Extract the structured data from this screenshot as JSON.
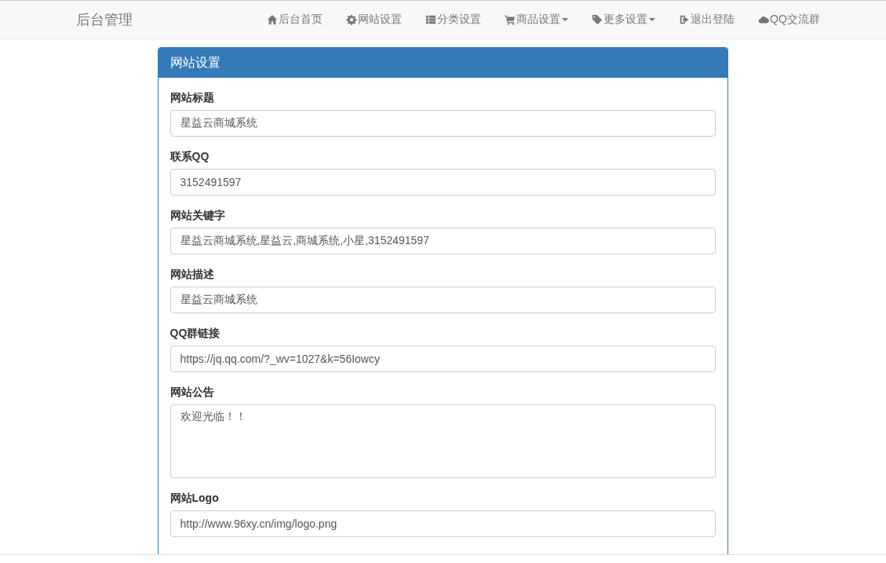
{
  "navbar": {
    "brand": "后台管理",
    "items": [
      {
        "label": "后台首页",
        "dropdown": false
      },
      {
        "label": "网站设置",
        "dropdown": false
      },
      {
        "label": "分类设置",
        "dropdown": false
      },
      {
        "label": "商品设置",
        "dropdown": true
      },
      {
        "label": "更多设置",
        "dropdown": true
      },
      {
        "label": "退出登陆",
        "dropdown": false
      },
      {
        "label": "QQ交流群",
        "dropdown": false
      }
    ]
  },
  "panel": {
    "title": "网站设置",
    "fields": [
      {
        "label": "网站标题",
        "kind": "input",
        "value": "星益云商城系统"
      },
      {
        "label": "联系QQ",
        "kind": "input",
        "value": "3152491597"
      },
      {
        "label": "网站关键字",
        "kind": "input",
        "value": "星益云商城系统,星益云,商城系统,小星,3152491597"
      },
      {
        "label": "网站描述",
        "kind": "input",
        "value": "星益云商城系统"
      },
      {
        "label": "QQ群链接",
        "kind": "input",
        "value": "https://jq.qq.com/?_wv=1027&k=56Iowcy"
      },
      {
        "label": "网站公告",
        "kind": "textarea",
        "value": "欢迎光临！！"
      },
      {
        "label": "网站Logo",
        "kind": "input",
        "value": "http://www.96xy.cn/img/logo.png"
      }
    ]
  }
}
